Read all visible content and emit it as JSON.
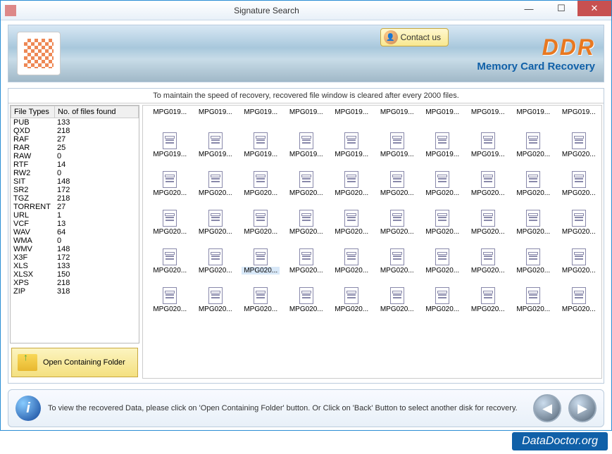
{
  "window": {
    "title": "Signature Search"
  },
  "banner": {
    "contact_label": "Contact us",
    "logo_text": "DDR",
    "subtitle": "Memory Card Recovery"
  },
  "notice": "To maintain the speed of recovery, recovered file window is cleared after every 2000 files.",
  "table": {
    "col1": "File Types",
    "col2": "No. of files found",
    "rows": [
      {
        "type": "PUB",
        "count": "133"
      },
      {
        "type": "QXD",
        "count": "218"
      },
      {
        "type": "RAF",
        "count": "27"
      },
      {
        "type": "RAR",
        "count": "25"
      },
      {
        "type": "RAW",
        "count": "0"
      },
      {
        "type": "RTF",
        "count": "14"
      },
      {
        "type": "RW2",
        "count": "0"
      },
      {
        "type": "SIT",
        "count": "148"
      },
      {
        "type": "SR2",
        "count": "172"
      },
      {
        "type": "TGZ",
        "count": "218"
      },
      {
        "type": "TORRENT",
        "count": "27"
      },
      {
        "type": "URL",
        "count": "1"
      },
      {
        "type": "VCF",
        "count": "13"
      },
      {
        "type": "WAV",
        "count": "64"
      },
      {
        "type": "WMA",
        "count": "0"
      },
      {
        "type": "WMV",
        "count": "148"
      },
      {
        "type": "X3F",
        "count": "172"
      },
      {
        "type": "XLS",
        "count": "133"
      },
      {
        "type": "XLSX",
        "count": "150"
      },
      {
        "type": "XPS",
        "count": "218"
      },
      {
        "type": "ZIP",
        "count": "318"
      }
    ]
  },
  "open_folder_label": "Open Containing Folder",
  "files": {
    "label_row": [
      "MPG019...",
      "MPG019...",
      "MPG019...",
      "MPG019...",
      "MPG019...",
      "MPG019...",
      "MPG019...",
      "MPG019...",
      "MPG019...",
      "MPG019..."
    ],
    "rows": [
      [
        "MPG019...",
        "MPG019...",
        "MPG019...",
        "MPG019...",
        "MPG019...",
        "MPG019...",
        "MPG019...",
        "MPG019...",
        "MPG020...",
        "MPG020..."
      ],
      [
        "MPG020...",
        "MPG020...",
        "MPG020...",
        "MPG020...",
        "MPG020...",
        "MPG020...",
        "MPG020...",
        "MPG020...",
        "MPG020...",
        "MPG020..."
      ],
      [
        "MPG020...",
        "MPG020...",
        "MPG020...",
        "MPG020...",
        "MPG020...",
        "MPG020...",
        "MPG020...",
        "MPG020...",
        "MPG020...",
        "MPG020..."
      ],
      [
        "MPG020...",
        "MPG020...",
        "MPG020...",
        "MPG020...",
        "MPG020...",
        "MPG020...",
        "MPG020...",
        "MPG020...",
        "MPG020...",
        "MPG020..."
      ],
      [
        "MPG020...",
        "MPG020...",
        "MPG020...",
        "MPG020...",
        "MPG020...",
        "MPG020...",
        "MPG020...",
        "MPG020...",
        "MPG020...",
        "MPG020..."
      ]
    ],
    "selected_row": 3,
    "selected_col": 2
  },
  "footer": {
    "text": "To view the recovered Data, please click on 'Open Containing Folder' button. Or Click on 'Back' Button to select another disk for recovery."
  },
  "brand": "DataDoctor.org"
}
